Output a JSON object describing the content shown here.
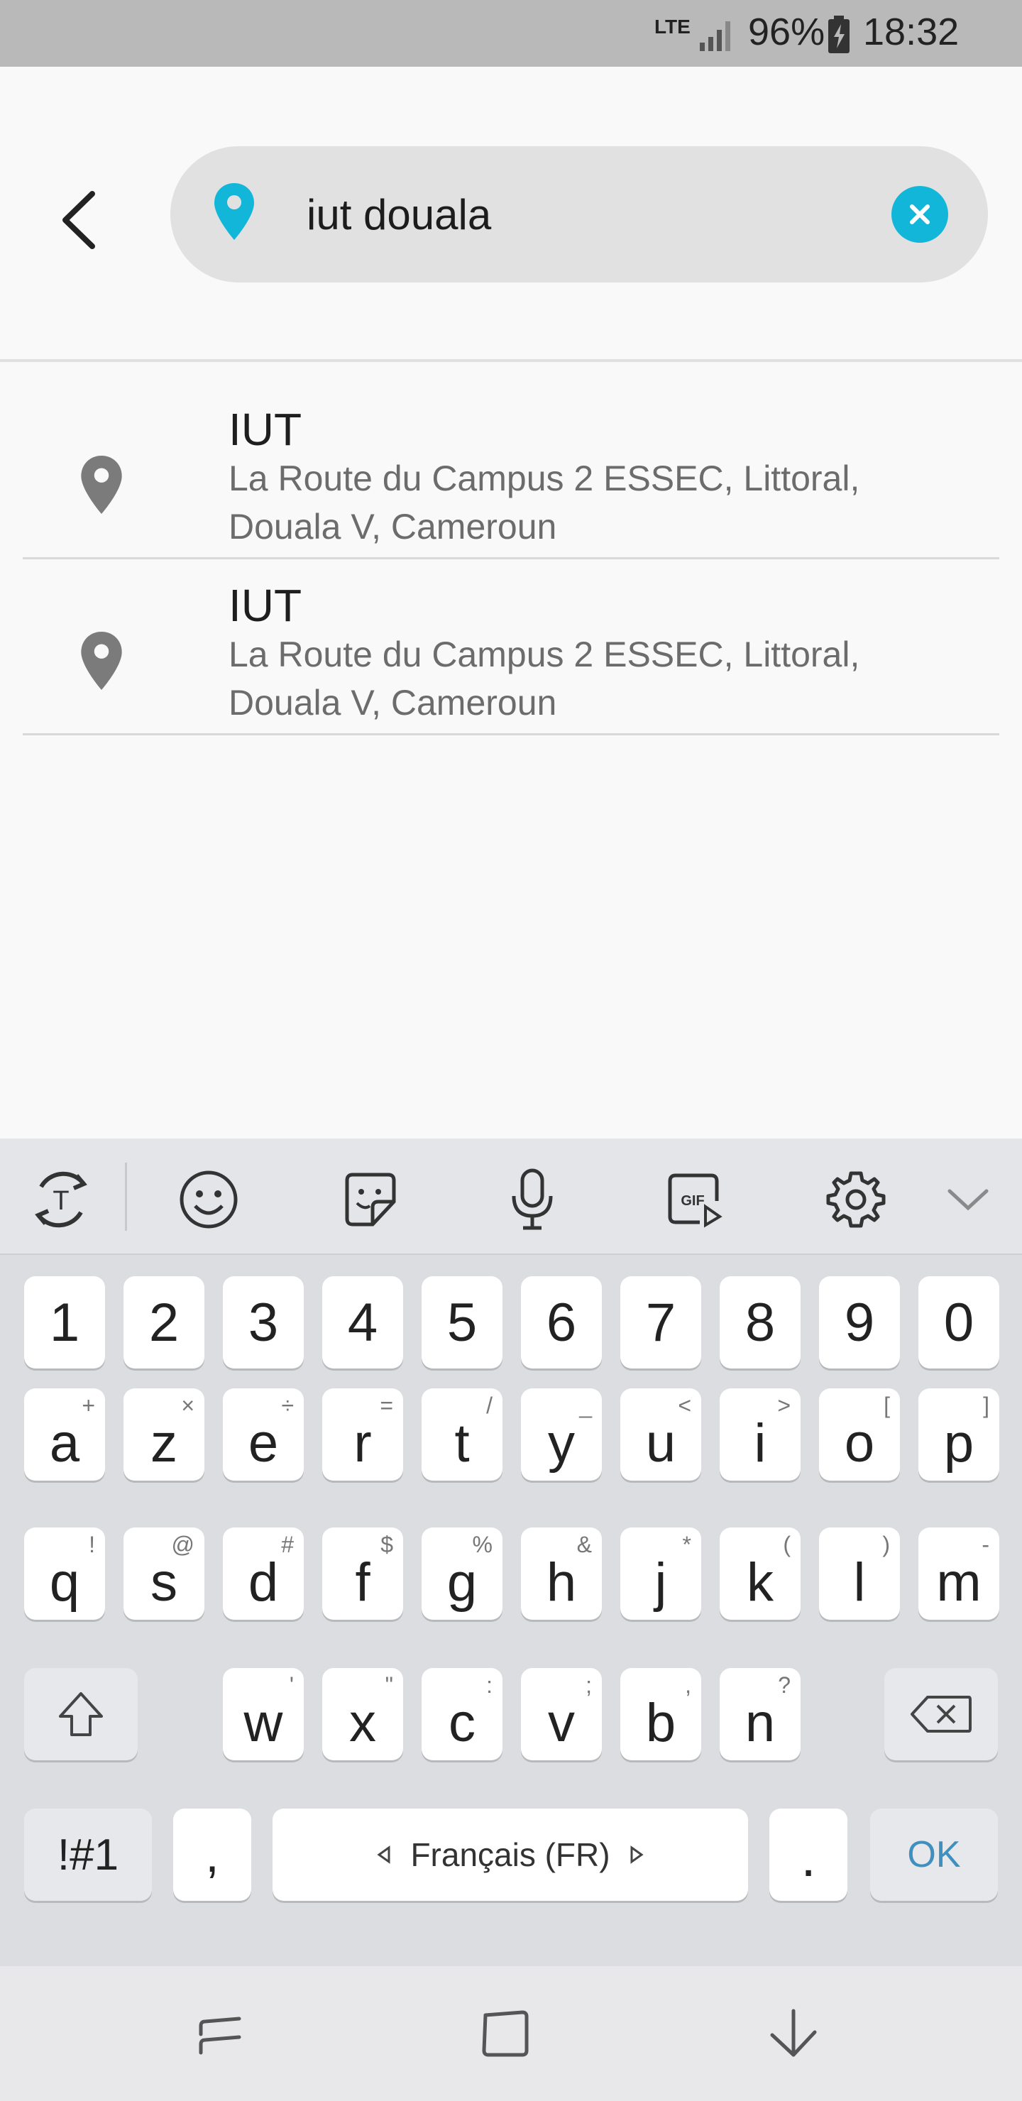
{
  "status_bar": {
    "network": "LTE",
    "battery": "96%",
    "time": "18:32"
  },
  "search": {
    "query": "iut douala",
    "back_icon": "chevron-left-icon",
    "location_icon": "map-pin-icon",
    "clear_icon": "clear-icon"
  },
  "results": [
    {
      "title": "IUT",
      "address_line1": "La Route du Campus 2 ESSEC, Littoral,",
      "address_line2": "Douala V, Cameroun"
    },
    {
      "title": "IUT",
      "address_line1": "La Route du Campus 2 ESSEC, Littoral,",
      "address_line2": "Douala V, Cameroun"
    }
  ],
  "keyboard": {
    "toolbar": [
      "translate-icon",
      "emoji-icon",
      "sticker-icon",
      "microphone-icon",
      "gif-icon",
      "settings-icon",
      "collapse-icon"
    ],
    "row_numbers": [
      "1",
      "2",
      "3",
      "4",
      "5",
      "6",
      "7",
      "8",
      "9",
      "0"
    ],
    "row1": [
      {
        "k": "a",
        "s": "+"
      },
      {
        "k": "z",
        "s": "×"
      },
      {
        "k": "e",
        "s": "÷"
      },
      {
        "k": "r",
        "s": "="
      },
      {
        "k": "t",
        "s": "/"
      },
      {
        "k": "y",
        "s": "_"
      },
      {
        "k": "u",
        "s": "<"
      },
      {
        "k": "i",
        "s": ">"
      },
      {
        "k": "o",
        "s": "["
      },
      {
        "k": "p",
        "s": "]"
      }
    ],
    "row2": [
      {
        "k": "q",
        "s": "!"
      },
      {
        "k": "s",
        "s": "@"
      },
      {
        "k": "d",
        "s": "#"
      },
      {
        "k": "f",
        "s": "$"
      },
      {
        "k": "g",
        "s": "%"
      },
      {
        "k": "h",
        "s": "&"
      },
      {
        "k": "j",
        "s": "*"
      },
      {
        "k": "k",
        "s": "("
      },
      {
        "k": "l",
        "s": ")"
      },
      {
        "k": "m",
        "s": "-"
      }
    ],
    "row3": [
      {
        "k": "w",
        "s": "'"
      },
      {
        "k": "x",
        "s": "\""
      },
      {
        "k": "c",
        "s": ":"
      },
      {
        "k": "v",
        "s": ";"
      },
      {
        "k": "b",
        "s": ","
      },
      {
        "k": "n",
        "s": "?"
      }
    ],
    "symbols_label": "!#1",
    "comma_label": ",",
    "space_label": "Français (FR)",
    "period_label": ".",
    "ok_label": "OK"
  },
  "nav_bar": [
    "recents-icon",
    "home-icon",
    "back-icon"
  ],
  "colors": {
    "accent": "#11b6d8",
    "ok_text": "#3f8fbf"
  }
}
